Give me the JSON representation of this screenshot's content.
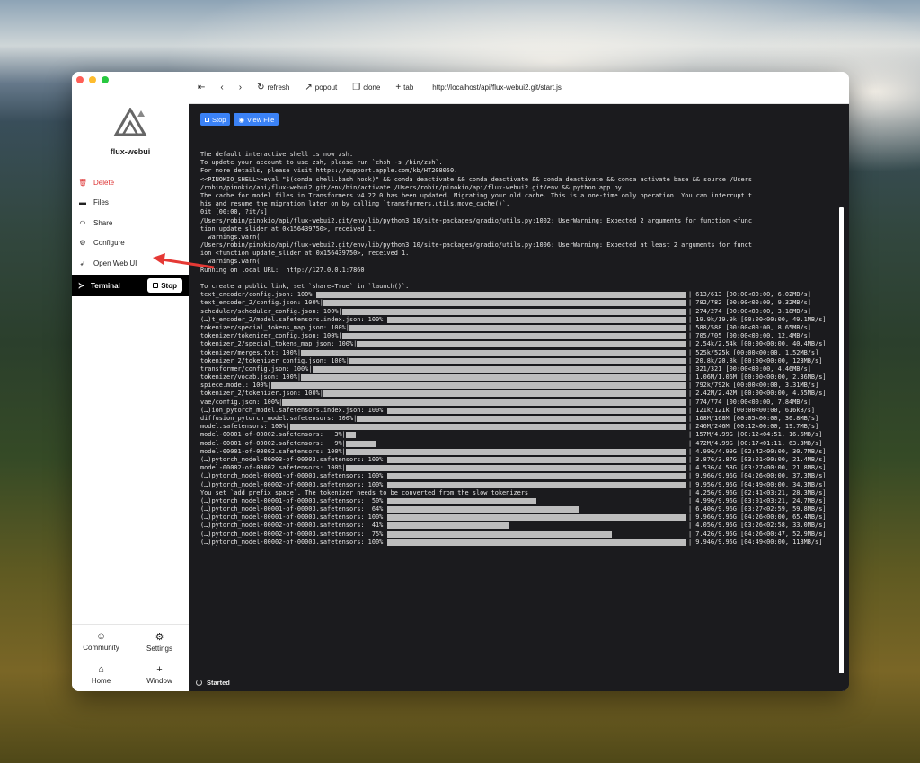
{
  "traffic_colors": [
    "#ff5f57",
    "#febc2e",
    "#28c840"
  ],
  "sidebar": {
    "app_name": "flux-webui",
    "items": [
      {
        "label": "Delete",
        "icon": "trash-icon",
        "name": "delete"
      },
      {
        "label": "Files",
        "icon": "folder-icon",
        "name": "files"
      },
      {
        "label": "Share",
        "icon": "wifi-icon",
        "name": "share"
      },
      {
        "label": "Configure",
        "icon": "gear-icon",
        "name": "configure"
      },
      {
        "label": "Open Web UI",
        "icon": "rocket-icon",
        "name": "open-web-ui"
      }
    ],
    "terminal": {
      "label": "Terminal",
      "stop_label": "Stop"
    },
    "bottom": [
      {
        "label": "Community",
        "icon": "smiley-icon"
      },
      {
        "label": "Settings",
        "icon": "gear-icon"
      },
      {
        "label": "Home",
        "icon": "home-icon"
      },
      {
        "label": "Window",
        "icon": "plus-icon"
      }
    ]
  },
  "toolbar": {
    "refresh": "refresh",
    "popout": "popout",
    "clone": "clone",
    "tab": "tab",
    "url": "http://localhost/api/flux-webui2.git/start.js"
  },
  "main": {
    "stop_label": "Stop",
    "view_label": "View File"
  },
  "status": {
    "text": "Started"
  },
  "terminal_lines": [
    "The default interactive shell is now zsh.",
    "To update your account to use zsh, please run `chsh -s /bin/zsh`.",
    "For more details, please visit https://support.apple.com/kb/HT208050.",
    "<<PINOKIO_SHELL>>eval \"$(conda shell.bash hook)\" && conda deactivate && conda deactivate && conda deactivate && conda activate base && source /Users",
    "/robin/pinokio/api/flux-webui2.git/env/bin/activate /Users/robin/pinokio/api/flux-webui2.git/env && python app.py",
    "The cache for model files in Transformers v4.22.0 has been updated. Migrating your old cache. This is a one-time only operation. You can interrupt t",
    "his and resume the migration later on by calling `transformers.utils.move_cache()`.",
    "0it [00:00, ?it/s]",
    "/Users/robin/pinokio/api/flux-webui2.git/env/lib/python3.10/site-packages/gradio/utils.py:1002: UserWarning: Expected 2 arguments for function <func",
    "tion update_slider at 0x156439750>, received 1.",
    "  warnings.warn(",
    "/Users/robin/pinokio/api/flux-webui2.git/env/lib/python3.10/site-packages/gradio/utils.py:1006: UserWarning: Expected at least 2 arguments for funct",
    "ion <function update_slider at 0x156439750>, received 1.",
    "  warnings.warn(",
    "Running on local URL:  http://127.0.0.1:7860",
    "",
    "To create a public link, set `share=True` in `launch()`."
  ],
  "progress": [
    {
      "label": "text_encoder/config.json: 100%|",
      "pct": 1.0,
      "stat": "| 613/613 [00:00<00:00, 6.02MB/s]"
    },
    {
      "label": "text_encoder_2/config.json: 100%|",
      "pct": 1.0,
      "stat": "| 782/782 [00:00<00:00, 9.32MB/s]"
    },
    {
      "label": "scheduler/scheduler_config.json: 100%|",
      "pct": 1.0,
      "stat": "| 274/274 [00:00<00:00, 3.18MB/s]"
    },
    {
      "label": "(…)t_encoder_2/model.safetensors.index.json: 100%|",
      "pct": 1.0,
      "stat": "| 19.9k/19.9k [00:00<00:00, 49.1MB/s]"
    },
    {
      "label": "tokenizer/special_tokens_map.json: 100%|",
      "pct": 1.0,
      "stat": "| 588/588 [00:00<00:00, 8.65MB/s]"
    },
    {
      "label": "tokenizer/tokenizer_config.json: 100%|",
      "pct": 1.0,
      "stat": "| 705/705 [00:00<00:00, 12.4MB/s]"
    },
    {
      "label": "tokenizer_2/special_tokens_map.json: 100%|",
      "pct": 1.0,
      "stat": "| 2.54k/2.54k [00:00<00:00, 40.4MB/s]"
    },
    {
      "label": "tokenizer/merges.txt: 100%|",
      "pct": 1.0,
      "stat": "| 525k/525k [00:00<00:00, 1.52MB/s]"
    },
    {
      "label": "tokenizer_2/tokenizer_config.json: 100%|",
      "pct": 1.0,
      "stat": "| 20.8k/20.8k [00:00<00:00, 123MB/s]"
    },
    {
      "label": "transformer/config.json: 100%|",
      "pct": 1.0,
      "stat": "| 321/321 [00:00<00:00, 4.46MB/s]"
    },
    {
      "label": "tokenizer/vocab.json: 100%|",
      "pct": 1.0,
      "stat": "| 1.06M/1.06M [00:00<00:00, 2.36MB/s]"
    },
    {
      "label": "spiece.model: 100%|",
      "pct": 1.0,
      "stat": "| 792k/792k [00:00<00:00, 3.31MB/s]"
    },
    {
      "label": "tokenizer_2/tokenizer.json: 100%|",
      "pct": 1.0,
      "stat": "| 2.42M/2.42M [00:00<00:00, 4.55MB/s]"
    },
    {
      "label": "vae/config.json: 100%|",
      "pct": 1.0,
      "stat": "| 774/774 [00:00<00:00, 7.84MB/s]"
    },
    {
      "label": "(…)ion_pytorch_model.safetensors.index.json: 100%|",
      "pct": 1.0,
      "stat": "| 121k/121k [00:00<00:00, 616kB/s]"
    },
    {
      "label": "diffusion_pytorch_model.safetensors: 100%|",
      "pct": 1.0,
      "stat": "| 168M/168M [00:05<00:00, 30.8MB/s]"
    },
    {
      "label": "model.safetensors: 100%|",
      "pct": 1.0,
      "stat": "| 246M/246M [00:12<00:00, 19.7MB/s]"
    },
    {
      "label": "model-00001-of-00002.safetensors:   3%|",
      "pct": 0.03,
      "stat": "| 157M/4.99G [00:12<04:51, 16.6MB/s]"
    },
    {
      "label": "model-00001-of-00002.safetensors:   9%|",
      "pct": 0.09,
      "stat": "| 472M/4.99G [00:17<01:11, 63.3MB/s]"
    },
    {
      "label": "model-00001-of-00002.safetensors: 100%|",
      "pct": 1.0,
      "stat": "| 4.99G/4.99G [02:42<00:00, 30.7MB/s]"
    },
    {
      "label": "(…)pytorch_model-00003-of-00003.safetensors: 100%|",
      "pct": 1.0,
      "stat": "| 3.87G/3.87G [03:01<00:00, 21.4MB/s]"
    },
    {
      "label": "model-00002-of-00002.safetensors: 100%|",
      "pct": 1.0,
      "stat": "| 4.53G/4.53G [03:27<00:00, 21.8MB/s]"
    },
    {
      "label": "(…)pytorch_model-00001-of-00003.safetensors: 100%|",
      "pct": 1.0,
      "stat": "| 9.96G/9.96G [04:26<00:00, 37.3MB/s]"
    },
    {
      "label": "(…)pytorch_model-00002-of-00003.safetensors: 100%|",
      "pct": 1.0,
      "stat": "| 9.95G/9.95G [04:49<00:00, 34.3MB/s]"
    },
    {
      "label": "You set `add_prefix_space`. The tokenizer needs to be converted from the slow tokenizers",
      "pct": null,
      "stat": "| 4.25G/9.96G [02:41<03:21, 28.3MB/s]"
    },
    {
      "label": "(…)pytorch_model-00001-of-00003.safetensors:  50%|",
      "pct": 0.5,
      "stat": "| 4.99G/9.96G [03:01<03:21, 24.7MB/s]"
    },
    {
      "label": "(…)pytorch_model-00001-of-00003.safetensors:  64%|",
      "pct": 0.64,
      "stat": "| 6.40G/9.96G [03:27<02:59, 59.8MB/s]"
    },
    {
      "label": "(…)pytorch_model-00001-of-00003.safetensors: 100%|",
      "pct": 1.0,
      "stat": "| 9.96G/9.96G [04:26<00:00, 65.4MB/s]"
    },
    {
      "label": "(…)pytorch_model-00002-of-00003.safetensors:  41%|",
      "pct": 0.41,
      "stat": "| 4.05G/9.95G [03:26<02:58, 33.0MB/s]"
    },
    {
      "label": "(…)pytorch_model-00002-of-00003.safetensors:  75%|",
      "pct": 0.75,
      "stat": "| 7.42G/9.95G [04:26<00:47, 52.9MB/s]"
    },
    {
      "label": "(…)pytorch_model-00002-of-00003.safetensors: 100%|",
      "pct": 1.0,
      "stat": "| 9.94G/9.95G [04:49<00:00, 113MB/s]"
    }
  ]
}
